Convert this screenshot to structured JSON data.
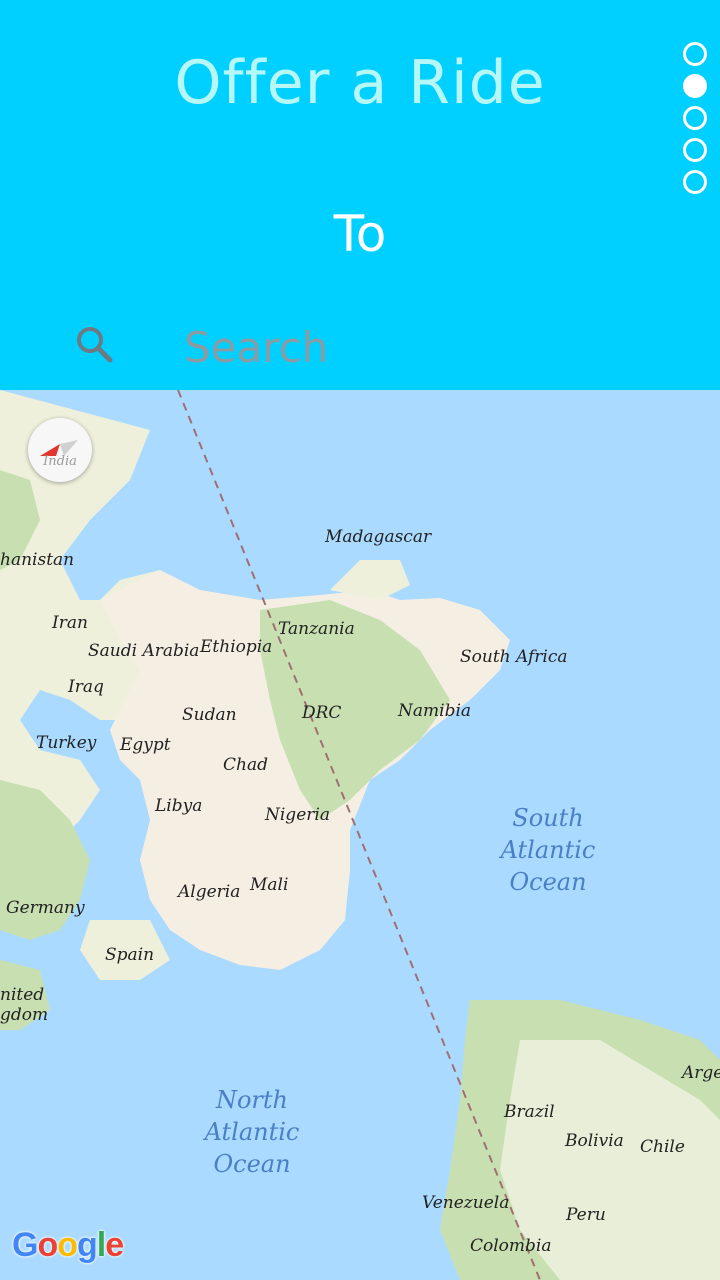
{
  "header": {
    "title": "Offer a Ride",
    "step_label": "To",
    "step_dots": [
      false,
      true,
      false,
      false,
      false
    ]
  },
  "search": {
    "placeholder": "Search",
    "icon": "search-icon"
  },
  "map": {
    "compass_label": "India",
    "attribution": "Google",
    "labels": [
      "Madagascar",
      "hanistan",
      "Iran",
      "Saudi Arabia",
      "Iraq",
      "Turkey",
      "Egypt",
      "Ethiopia",
      "Tanzania",
      "Sudan",
      "DRC",
      "Chad",
      "Libya",
      "Nigeria",
      "Algeria",
      "Mali",
      "Germany",
      "Spain",
      "nited",
      "gdom",
      "South Africa",
      "Namibia",
      "Brazil",
      "Bolivia",
      "Chile",
      "Argen",
      "Venezuela",
      "Peru",
      "Colombia"
    ],
    "oceans": [
      [
        "South",
        "Atlantic",
        "Ocean"
      ],
      [
        "North",
        "Atlantic",
        "Ocean"
      ]
    ]
  },
  "colors": {
    "header_bg": "#00d0ff",
    "title_color": "#b6f7f8",
    "water": "#aadaff",
    "land": "#f5efe3",
    "vegetation": "#c8e0b1"
  }
}
